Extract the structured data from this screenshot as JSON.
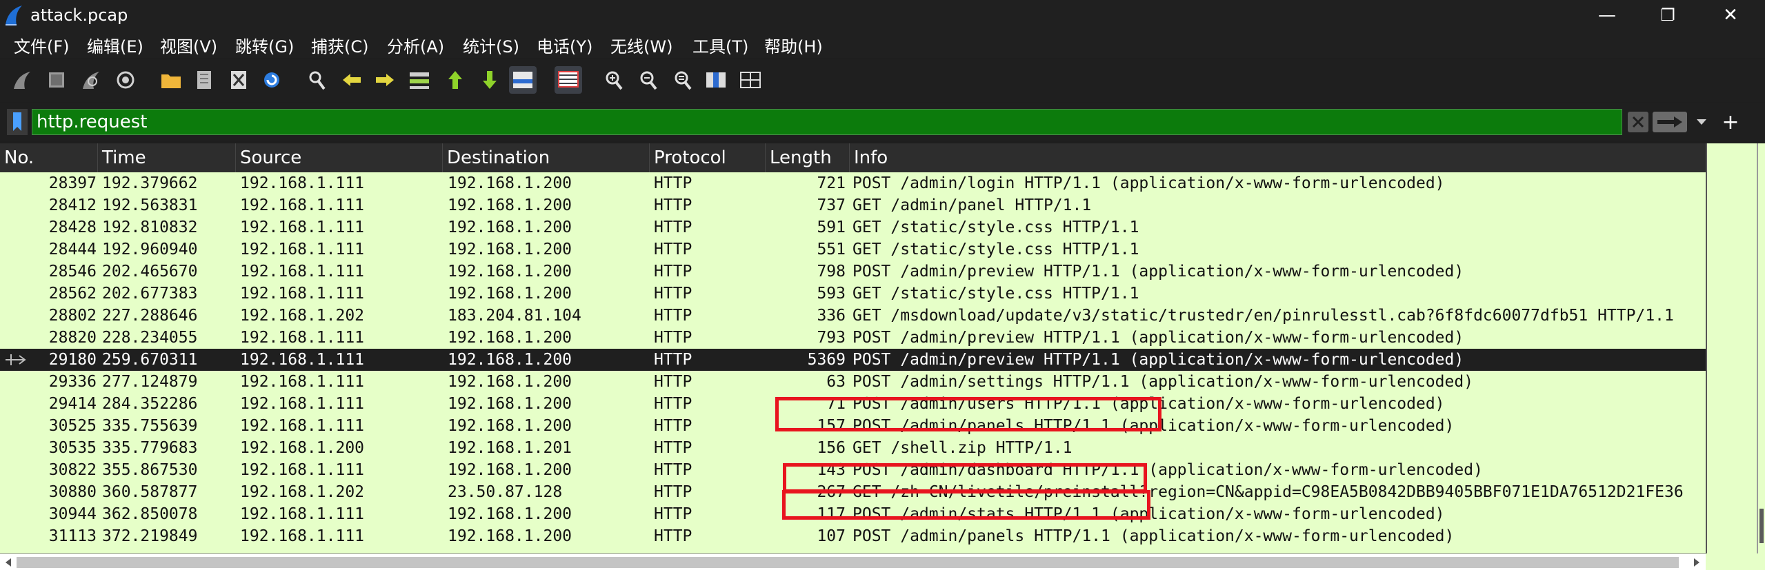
{
  "window": {
    "title": "attack.pcap",
    "minimize": "—",
    "maximize": "❐",
    "close": "✕"
  },
  "menu": [
    "文件(F)",
    "编辑(E)",
    "视图(V)",
    "跳转(G)",
    "捕获(C)",
    "分析(A)",
    "统计(S)",
    "电话(Y)",
    "无线(W)",
    "工具(T)",
    "帮助(H)"
  ],
  "toolbar": {
    "icons": [
      "shark-fin-start-icon",
      "stop-square-icon",
      "restart-fin-icon",
      "capture-options-gear-icon",
      "open-folder-icon",
      "save-file-icon",
      "close-file-icon",
      "reload-file-icon",
      "find-packet-icon",
      "go-back-arrow-icon",
      "go-forward-arrow-icon",
      "go-to-packet-icon",
      "go-first-arrow-icon",
      "go-last-arrow-icon",
      "autoscroll-icon",
      "colorize-icon",
      "zoom-in-icon",
      "zoom-out-icon",
      "normal-size-icon",
      "resize-columns-icon"
    ]
  },
  "filter": {
    "value": "http.request",
    "clear_icon": "clear-filter-icon",
    "apply_icon": "apply-filter-arrow-icon",
    "dropdown_icon": "chevron-down-icon",
    "add_label": "+"
  },
  "columns": [
    "No.",
    "Time",
    "Source",
    "Destination",
    "Protocol",
    "Length",
    "Info"
  ],
  "rows": [
    {
      "no": "28397",
      "time": "192.379662",
      "src": "192.168.1.111",
      "dst": "192.168.1.200",
      "proto": "HTTP",
      "len": "721",
      "info": "POST /admin/login HTTP/1.1  (application/x-www-form-urlencoded)"
    },
    {
      "no": "28412",
      "time": "192.563831",
      "src": "192.168.1.111",
      "dst": "192.168.1.200",
      "proto": "HTTP",
      "len": "737",
      "info": "GET /admin/panel HTTP/1.1"
    },
    {
      "no": "28428",
      "time": "192.810832",
      "src": "192.168.1.111",
      "dst": "192.168.1.200",
      "proto": "HTTP",
      "len": "591",
      "info": "GET /static/style.css HTTP/1.1"
    },
    {
      "no": "28444",
      "time": "192.960940",
      "src": "192.168.1.111",
      "dst": "192.168.1.200",
      "proto": "HTTP",
      "len": "551",
      "info": "GET /static/style.css HTTP/1.1"
    },
    {
      "no": "28546",
      "time": "202.465670",
      "src": "192.168.1.111",
      "dst": "192.168.1.200",
      "proto": "HTTP",
      "len": "798",
      "info": "POST /admin/preview HTTP/1.1  (application/x-www-form-urlencoded)"
    },
    {
      "no": "28562",
      "time": "202.677383",
      "src": "192.168.1.111",
      "dst": "192.168.1.200",
      "proto": "HTTP",
      "len": "593",
      "info": "GET /static/style.css HTTP/1.1"
    },
    {
      "no": "28802",
      "time": "227.288646",
      "src": "192.168.1.202",
      "dst": "183.204.81.104",
      "proto": "HTTP",
      "len": "336",
      "info": "GET /msdownload/update/v3/static/trustedr/en/pinrulesstl.cab?6f8fdc60077dfb51 HTTP/1.1"
    },
    {
      "no": "28820",
      "time": "228.234055",
      "src": "192.168.1.111",
      "dst": "192.168.1.200",
      "proto": "HTTP",
      "len": "793",
      "info": "POST /admin/preview HTTP/1.1  (application/x-www-form-urlencoded)"
    },
    {
      "no": "29180",
      "time": "259.670311",
      "src": "192.168.1.111",
      "dst": "192.168.1.200",
      "proto": "HTTP",
      "len": "5369",
      "info": "POST /admin/preview HTTP/1.1  (application/x-www-form-urlencoded)",
      "selected": true
    },
    {
      "no": "29336",
      "time": "277.124879",
      "src": "192.168.1.111",
      "dst": "192.168.1.200",
      "proto": "HTTP",
      "len": "63",
      "info": "POST /admin/settings HTTP/1.1  (application/x-www-form-urlencoded)"
    },
    {
      "no": "29414",
      "time": "284.352286",
      "src": "192.168.1.111",
      "dst": "192.168.1.200",
      "proto": "HTTP",
      "len": "71",
      "info": "POST /admin/users HTTP/1.1  (application/x-www-form-urlencoded)"
    },
    {
      "no": "30525",
      "time": "335.755639",
      "src": "192.168.1.111",
      "dst": "192.168.1.200",
      "proto": "HTTP",
      "len": "157",
      "info": "POST /admin/panels HTTP/1.1  (application/x-www-form-urlencoded)"
    },
    {
      "no": "30535",
      "time": "335.779683",
      "src": "192.168.1.200",
      "dst": "192.168.1.201",
      "proto": "HTTP",
      "len": "156",
      "info": "GET /shell.zip HTTP/1.1"
    },
    {
      "no": "30822",
      "time": "355.867530",
      "src": "192.168.1.111",
      "dst": "192.168.1.200",
      "proto": "HTTP",
      "len": "143",
      "info": "POST /admin/dashboard HTTP/1.1  (application/x-www-form-urlencoded)"
    },
    {
      "no": "30880",
      "time": "360.587877",
      "src": "192.168.1.202",
      "dst": "23.50.87.128",
      "proto": "HTTP",
      "len": "267",
      "info": "GET /zh-CN/livetile/preinstall?region=CN&appid=C98EA5B0842DBB9405BBF071E1DA76512D21FE36"
    },
    {
      "no": "30944",
      "time": "362.850078",
      "src": "192.168.1.111",
      "dst": "192.168.1.200",
      "proto": "HTTP",
      "len": "117",
      "info": "POST /admin/stats HTTP/1.1  (application/x-www-form-urlencoded)"
    },
    {
      "no": "31113",
      "time": "372.219849",
      "src": "192.168.1.111",
      "dst": "192.168.1.200",
      "proto": "HTTP",
      "len": "107",
      "info": "POST /admin/panels HTTP/1.1  (application/x-www-form-urlencoded)"
    }
  ],
  "colors": {
    "row_bg": "#e6ffc8",
    "selected_bg": "#1f1f1f",
    "filter_bg": "#0c7b0c",
    "highlight": "#e8141e"
  }
}
